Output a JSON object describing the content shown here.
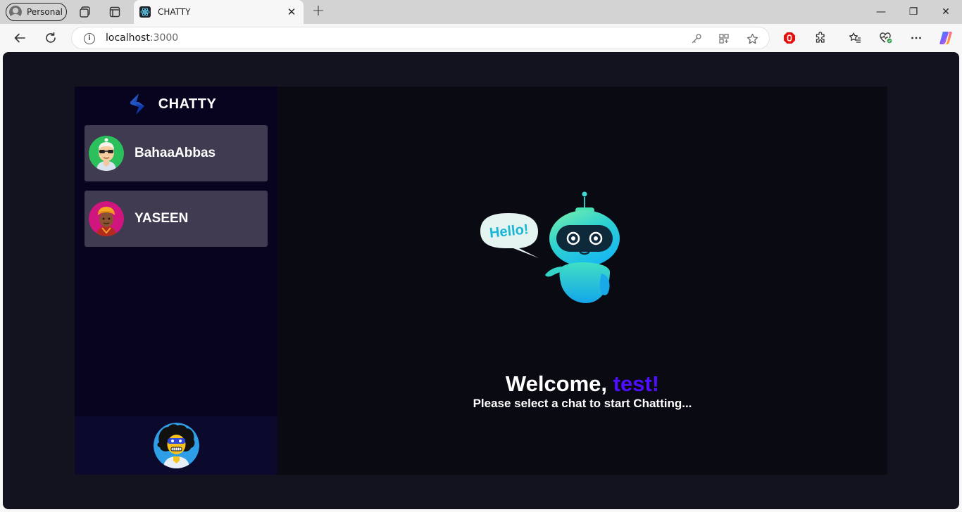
{
  "browser": {
    "profile_label": "Personal",
    "tab_title": "CHATTY",
    "tab_close": "✕",
    "new_tab": "+",
    "url_host": "localhost",
    "url_port": ":3000",
    "window_controls": {
      "minimize": "—",
      "restore": "❐",
      "close": "✕"
    }
  },
  "app": {
    "brand_name": "CHATTY",
    "contacts": [
      {
        "name": "BahaaAbbas",
        "avatar": "green-avatar-sunglasses"
      },
      {
        "name": "YASEEN",
        "avatar": "magenta-avatar-turban"
      }
    ],
    "current_user_avatar": "blue-avatar-afro-mask",
    "welcome": {
      "greeting": "Welcome, ",
      "username": "test!",
      "subtitle": "Please select a chat to start Chatting..."
    },
    "robot_bubble_text": "Hello!"
  },
  "colors": {
    "page_bg": "#13131f",
    "sidebar_bg": "#080420",
    "contact_bg": "#403b50",
    "main_bg": "#0a0a12",
    "accent": "#4e0eff"
  }
}
